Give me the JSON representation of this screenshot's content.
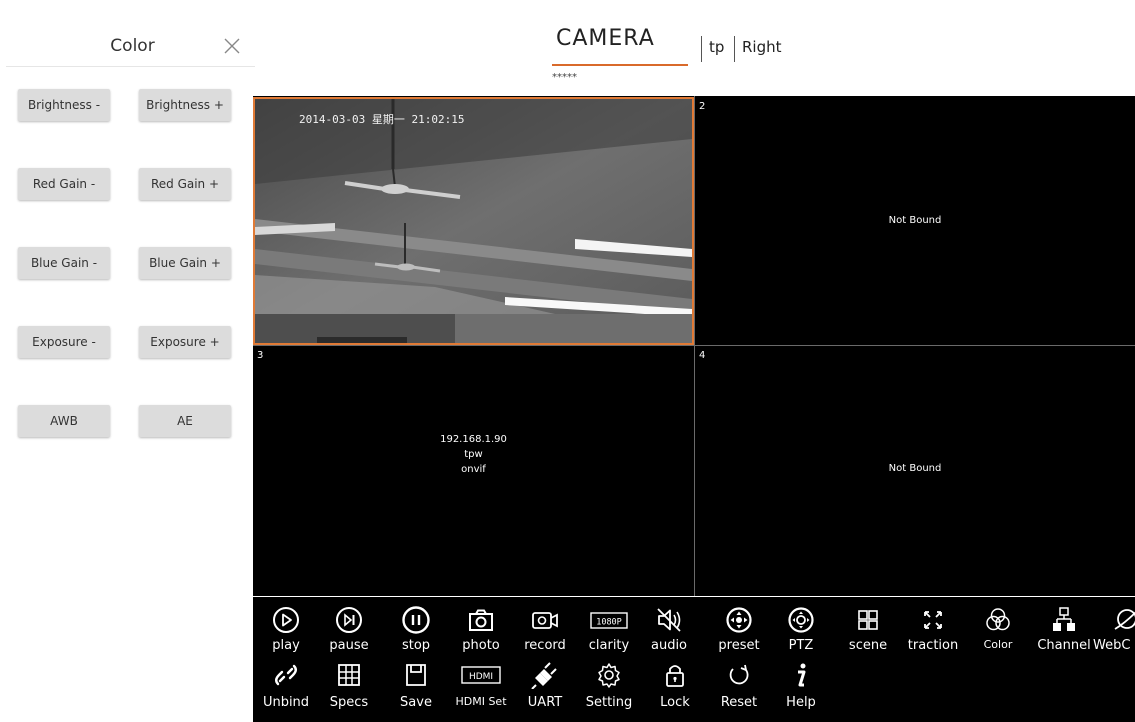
{
  "panel": {
    "title": "Color",
    "close_icon": "close-icon",
    "buttons": [
      {
        "label": "Brightness -"
      },
      {
        "label": "Brightness +"
      },
      {
        "label": "Red Gain -"
      },
      {
        "label": "Red Gain +"
      },
      {
        "label": "Blue Gain -"
      },
      {
        "label": "Blue Gain +"
      },
      {
        "label": "Exposure -"
      },
      {
        "label": "Exposure +"
      },
      {
        "label": "AWB"
      },
      {
        "label": "AE"
      }
    ]
  },
  "header": {
    "title": "CAMERA",
    "subtitle": "*****",
    "items": [
      "tp",
      "Right"
    ],
    "accent_color": "#d96a2b"
  },
  "grid": {
    "selected_border_color": "#e07a36",
    "cells": [
      {
        "number": "",
        "timestamp": "2014-03-03 星期一 21:02:15"
      },
      {
        "number": "2",
        "message": "Not Bound"
      },
      {
        "number": "3",
        "lines": [
          "192.168.1.90",
          "tpw",
          "onvif"
        ]
      },
      {
        "number": "4",
        "message": "Not Bound"
      }
    ]
  },
  "toolbar": {
    "row1": [
      {
        "label": "play",
        "icon": "play-icon"
      },
      {
        "label": "pause",
        "icon": "pause-icon"
      },
      {
        "label": "stop",
        "icon": "stop-icon"
      },
      {
        "label": "photo",
        "icon": "camera-icon"
      },
      {
        "label": "record",
        "icon": "video-record-icon"
      },
      {
        "label": "clarity",
        "icon": "clarity-1080p-icon",
        "badge": "1080P"
      },
      {
        "label": "audio",
        "icon": "audio-mute-icon"
      },
      {
        "label": "preset",
        "icon": "preset-icon"
      },
      {
        "label": "PTZ",
        "icon": "ptz-icon"
      },
      {
        "label": "scene",
        "icon": "scene-grid-icon"
      },
      {
        "label": "traction",
        "icon": "traction-arrows-icon"
      },
      {
        "label": "Color",
        "icon": "color-circles-icon"
      },
      {
        "label": "Channel",
        "icon": "channel-network-icon"
      },
      {
        "label": "WebC",
        "icon": "webcam-icon"
      }
    ],
    "row2": [
      {
        "label": "Unbind",
        "icon": "unbind-link-icon"
      },
      {
        "label": "Specs",
        "icon": "specs-grid-icon"
      },
      {
        "label": "Save",
        "icon": "save-icon"
      },
      {
        "label": "HDMI Set",
        "icon": "hdmi-icon",
        "badge": "HDMI"
      },
      {
        "label": "UART",
        "icon": "uart-plug-icon"
      },
      {
        "label": "Setting",
        "icon": "gear-icon"
      },
      {
        "label": "Lock",
        "icon": "lock-icon"
      },
      {
        "label": "Reset",
        "icon": "reset-icon"
      },
      {
        "label": "Help",
        "icon": "help-info-icon"
      }
    ]
  }
}
